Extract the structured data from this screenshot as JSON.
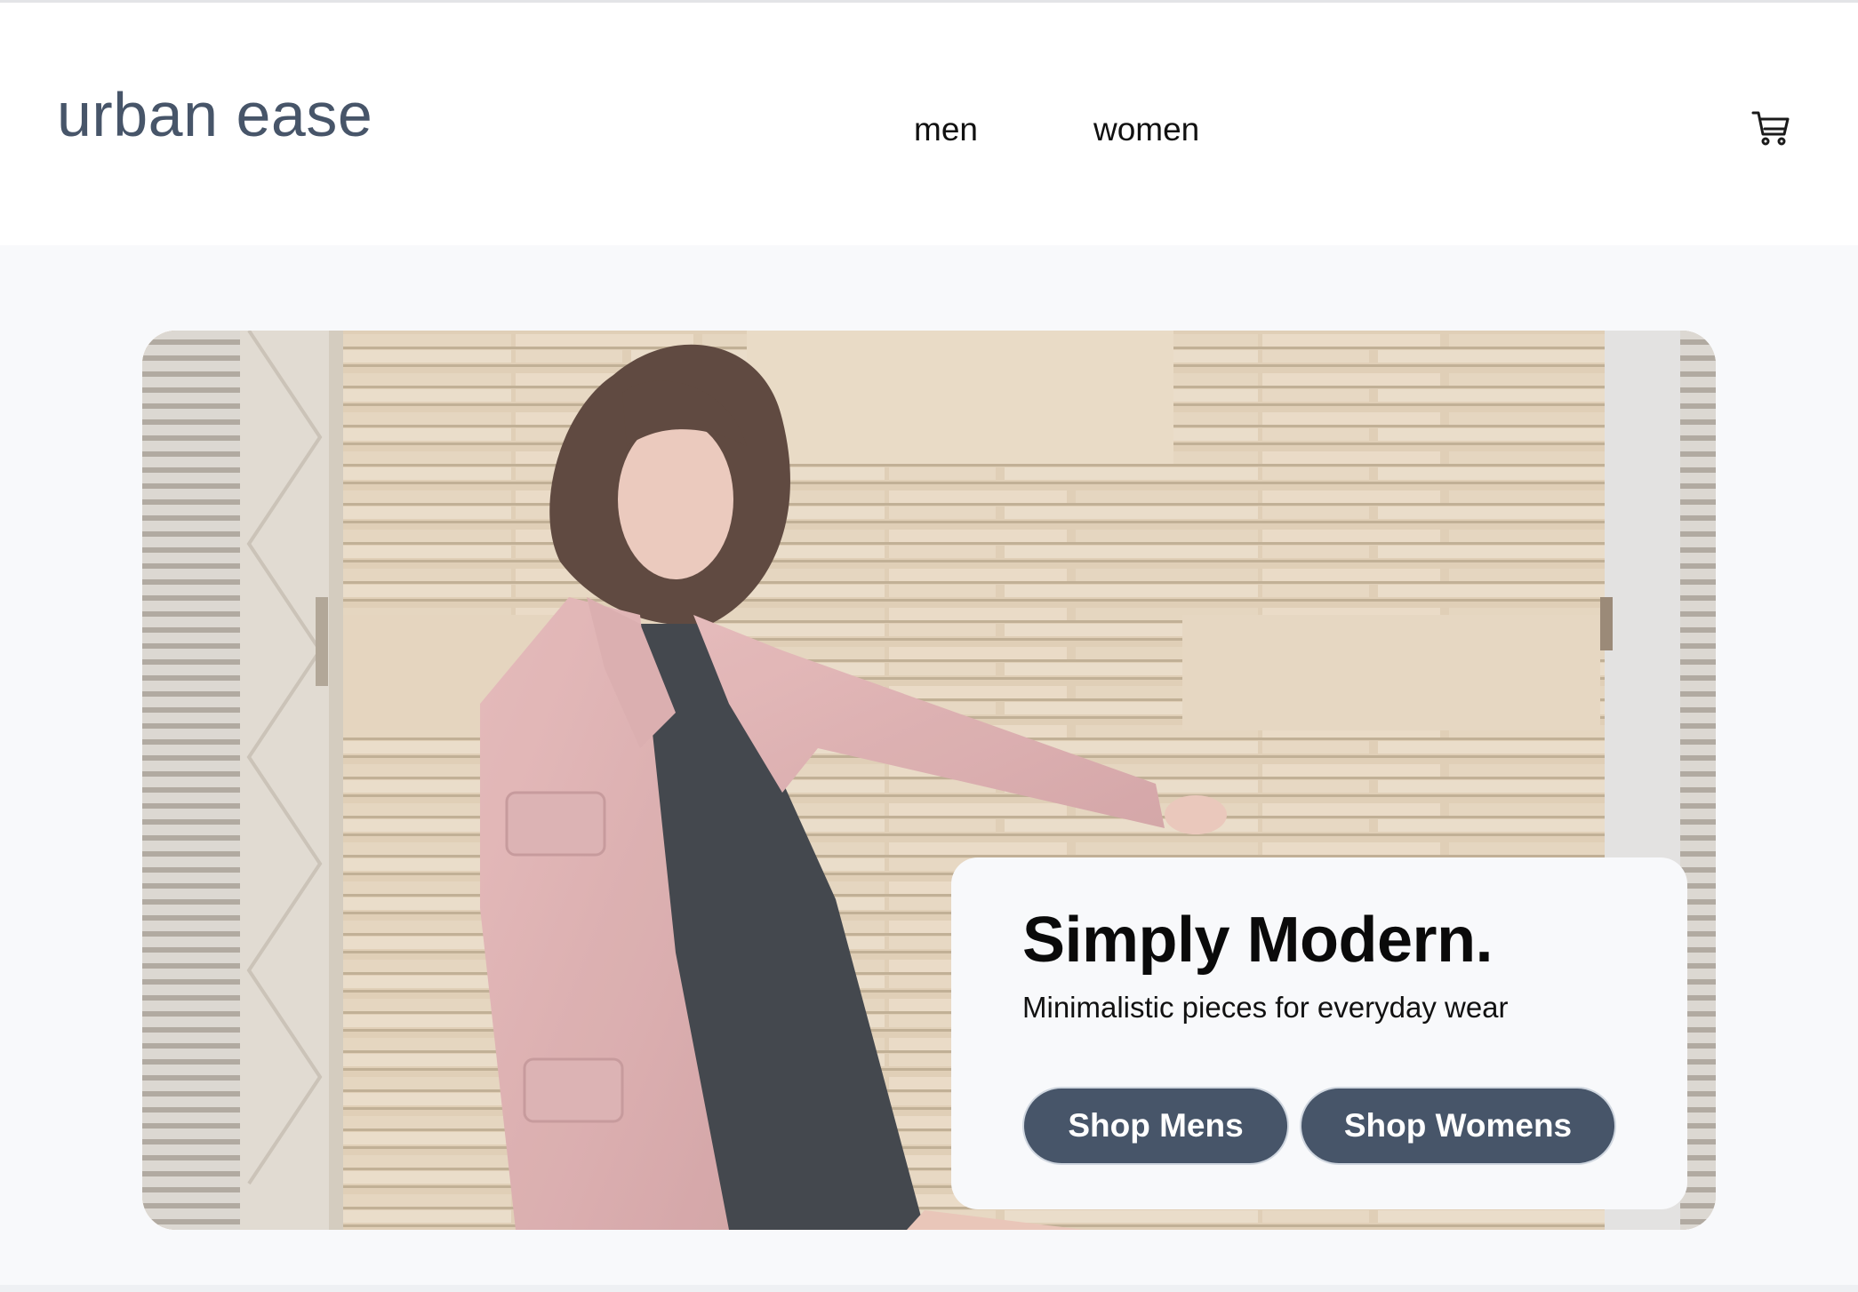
{
  "brand": {
    "logo_text": "urban ease",
    "logo_color": "#475569"
  },
  "nav": {
    "men_label": "men",
    "women_label": "women"
  },
  "header": {
    "cart_icon": "shopping-cart-icon"
  },
  "hero": {
    "image_description": "Woman in pink coat and black dress against beige stone wall",
    "title": "Simply Modern.",
    "subtitle": "Minimalistic pieces for everyday wear",
    "shop_mens_label": "Shop Mens",
    "shop_womens_label": "Shop Womens",
    "button_color": "#475569"
  }
}
